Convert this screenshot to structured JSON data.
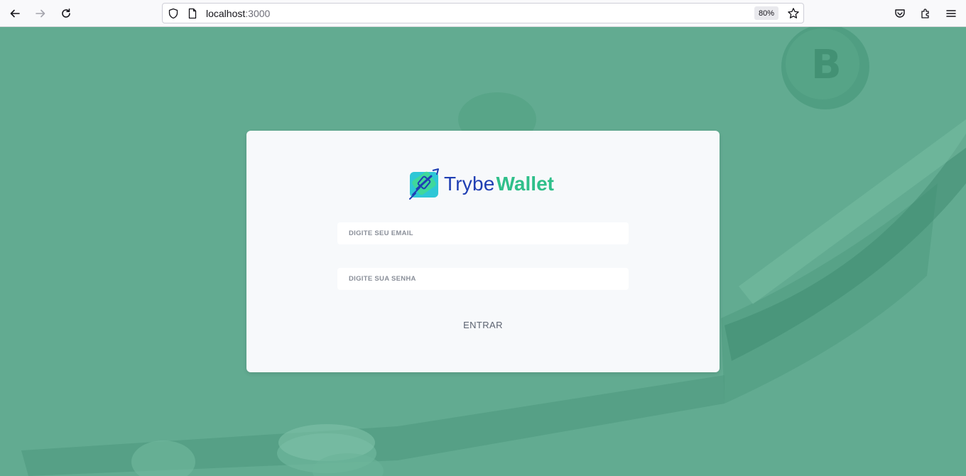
{
  "browser": {
    "url_host": "localhost",
    "url_port": ":3000",
    "zoom": "80%",
    "icons": [
      "back-arrow-icon",
      "forward-arrow-icon",
      "reload-icon",
      "shield-icon",
      "page-icon",
      "star-icon",
      "pocket-icon",
      "extensions-icon",
      "menu-icon"
    ]
  },
  "login": {
    "logo_word1": "Trybe",
    "logo_word2": "Wallet",
    "email_placeholder": "DIGITE SEU EMAIL",
    "password_placeholder": "DIGITE SUA SENHA",
    "submit_label": "ENTRAR"
  },
  "colors": {
    "background": "#62ab91",
    "card": "#f7f9fb",
    "brand_blue": "#1f3fb3",
    "brand_green": "#2fbf8a"
  }
}
